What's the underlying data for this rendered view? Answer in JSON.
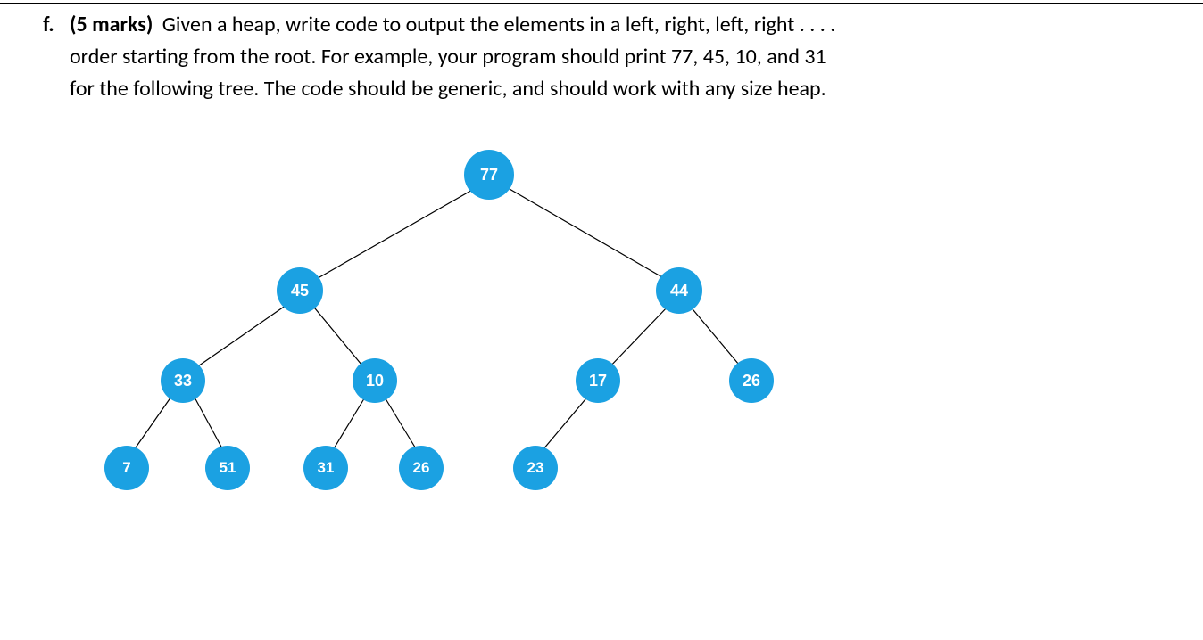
{
  "question": {
    "letter": "f.",
    "marks": "(5 marks)",
    "text_line1": " Given a heap, write code to output the elements in a left, right, left, right . . . .",
    "text_line2": "order starting from the root. For example, your program should print 77, 45, 10, and 31",
    "text_line3": "for the following tree. The code should be generic, and should work with any size heap."
  },
  "tree": {
    "root": "77",
    "level2_left": "45",
    "level2_right": "44",
    "level3": {
      "n1": "33",
      "n2": "10",
      "n3": "17",
      "n4": "26"
    },
    "level4": {
      "n1": "7",
      "n2": "51",
      "n3": "31",
      "n4": "26",
      "n5": "23"
    }
  },
  "chart_data": {
    "type": "tree",
    "description": "Binary heap tree diagram",
    "nodes": [
      {
        "id": 0,
        "value": 77,
        "parent": null,
        "level": 0
      },
      {
        "id": 1,
        "value": 45,
        "parent": 0,
        "side": "left",
        "level": 1
      },
      {
        "id": 2,
        "value": 44,
        "parent": 0,
        "side": "right",
        "level": 1
      },
      {
        "id": 3,
        "value": 33,
        "parent": 1,
        "side": "left",
        "level": 2
      },
      {
        "id": 4,
        "value": 10,
        "parent": 1,
        "side": "right",
        "level": 2
      },
      {
        "id": 5,
        "value": 17,
        "parent": 2,
        "side": "left",
        "level": 2
      },
      {
        "id": 6,
        "value": 26,
        "parent": 2,
        "side": "right",
        "level": 2
      },
      {
        "id": 7,
        "value": 7,
        "parent": 3,
        "side": "left",
        "level": 3
      },
      {
        "id": 8,
        "value": 51,
        "parent": 3,
        "side": "right",
        "level": 3
      },
      {
        "id": 9,
        "value": 31,
        "parent": 4,
        "side": "left",
        "level": 3
      },
      {
        "id": 10,
        "value": 26,
        "parent": 4,
        "side": "right",
        "level": 3
      },
      {
        "id": 11,
        "value": 23,
        "parent": 5,
        "side": "left",
        "level": 3
      }
    ],
    "expected_output": [
      77,
      45,
      10,
      31
    ]
  }
}
